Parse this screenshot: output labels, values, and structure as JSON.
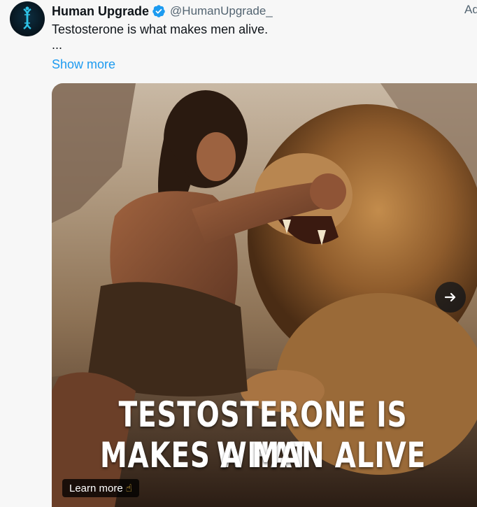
{
  "tweet": {
    "display_name": "Human Upgrade",
    "handle": "@HumanUpgrade_",
    "ad_label": "Ad",
    "text": "Testosterone is what makes men alive.",
    "ellipsis": "...",
    "show_more": "Show more"
  },
  "media": {
    "overlay_line1": "TESTOSTERONE IS WHAT",
    "overlay_line2": "MAKES A MAN ALIVE",
    "learn_more": "Learn more",
    "learn_more_emoji": "☝",
    "next_icon": "arrow-right-icon"
  },
  "colors": {
    "link": "#1d9bf0",
    "verified": "#1d9bf0",
    "text": "#0f1419",
    "secondary": "#536471"
  }
}
